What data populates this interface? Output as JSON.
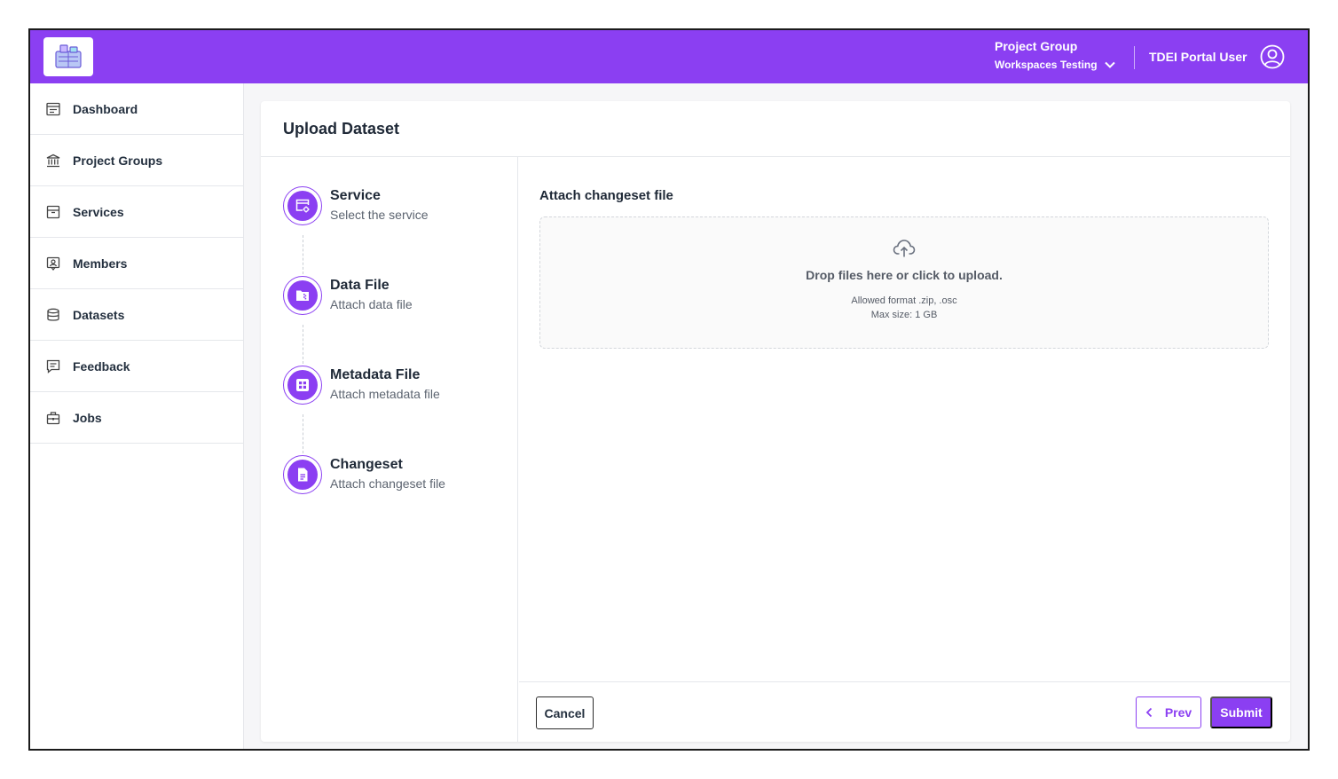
{
  "header": {
    "project_group_label": "Project Group",
    "project_group_value": "Workspaces Testing",
    "user_name": "TDEI Portal User"
  },
  "sidebar": {
    "items": [
      {
        "label": "Dashboard",
        "icon": "dashboard-icon"
      },
      {
        "label": "Project Groups",
        "icon": "bank-icon"
      },
      {
        "label": "Services",
        "icon": "archive-icon"
      },
      {
        "label": "Members",
        "icon": "member-icon"
      },
      {
        "label": "Datasets",
        "icon": "database-icon"
      },
      {
        "label": "Feedback",
        "icon": "feedback-icon"
      },
      {
        "label": "Jobs",
        "icon": "briefcase-icon"
      }
    ]
  },
  "page": {
    "title": "Upload Dataset"
  },
  "steps": [
    {
      "title": "Service",
      "subtitle": "Select the service",
      "icon": "service-icon"
    },
    {
      "title": "Data File",
      "subtitle": "Attach data file",
      "icon": "folder-file-icon"
    },
    {
      "title": "Metadata File",
      "subtitle": "Attach metadata file",
      "icon": "grid-icon"
    },
    {
      "title": "Changeset",
      "subtitle": "Attach changeset file",
      "icon": "document-icon"
    }
  ],
  "upload": {
    "label": "Attach changeset file",
    "drop_text": "Drop files here or click to upload.",
    "allowed_format": "Allowed format .zip, .osc",
    "max_size": "Max size: 1 GB"
  },
  "footer": {
    "cancel_label": "Cancel",
    "prev_label": "Prev",
    "submit_label": "Submit"
  },
  "colors": {
    "accent": "#8b3ff2"
  }
}
